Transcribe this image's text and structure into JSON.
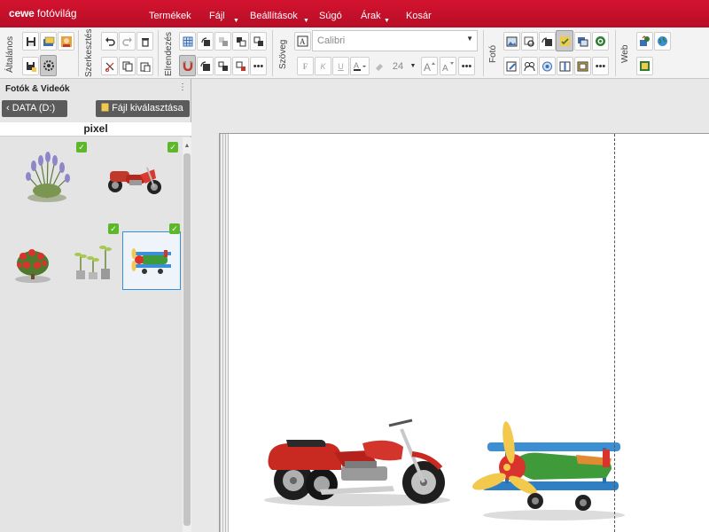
{
  "app": {
    "brand": "cewe",
    "brand_suffix": "fotóvilág"
  },
  "menu": [
    {
      "label": "Termékek",
      "has_dropdown": false
    },
    {
      "label": "Fájl",
      "has_dropdown": true
    },
    {
      "label": "Beállítások",
      "has_dropdown": true
    },
    {
      "label": "Súgó",
      "has_dropdown": false
    },
    {
      "label": "Árak",
      "has_dropdown": true
    },
    {
      "label": "Kosár",
      "has_dropdown": false
    }
  ],
  "ribbon": {
    "groups": [
      "Általános",
      "Szerkesztés",
      "Elrendezés",
      "Szöveg",
      "Fotó",
      "Web"
    ],
    "font_name_placeholder": "Calibri",
    "font_size": "24",
    "text_format_buttons": [
      "F",
      "K",
      "U"
    ]
  },
  "left_panel": {
    "title": "Fotók & Videók",
    "drive_button": "DATA (D:)",
    "file_button": "Fájl kiválasztása",
    "folder_name": "pixel",
    "thumbnails": [
      {
        "subject": "lavender plant",
        "checked": true,
        "selected": false
      },
      {
        "subject": "red motorcycle trike",
        "checked": true,
        "selected": false
      },
      {
        "subject": "red flowering bush",
        "checked": false,
        "selected": false
      },
      {
        "subject": "potted seedlings",
        "checked": true,
        "selected": false
      },
      {
        "subject": "toy airplane",
        "checked": true,
        "selected": true
      }
    ]
  },
  "colors": {
    "brand_red": "#c8102e",
    "check_green": "#5cb82a",
    "selection_blue": "#3a8fd6"
  }
}
